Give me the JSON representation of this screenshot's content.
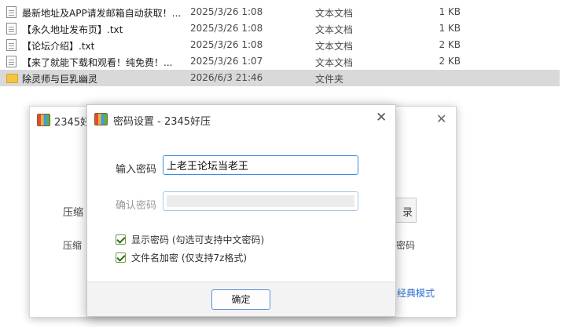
{
  "files": [
    {
      "name": "最新地址及APP请发邮箱自动获取！...",
      "date": "2025/3/26 1:08",
      "type": "文本文档",
      "size": "1 KB",
      "icon": "text-file-icon"
    },
    {
      "name": "【永久地址发布页】.txt",
      "date": "2025/3/26 1:08",
      "type": "文本文档",
      "size": "1 KB",
      "icon": "text-file-icon"
    },
    {
      "name": "【论坛介绍】.txt",
      "date": "2025/3/26 1:08",
      "type": "文本文档",
      "size": "2 KB",
      "icon": "text-file-icon"
    },
    {
      "name": "【来了就能下载和观看！纯免费！...",
      "date": "2025/3/26 1:07",
      "type": "文本文档",
      "size": "2 KB",
      "icon": "text-file-icon"
    },
    {
      "name": "除灵师与巨乳幽灵",
      "date": "2026/6/3 21:46",
      "type": "文件夹",
      "size": "",
      "icon": "folder-icon"
    }
  ],
  "main_window": {
    "title": "2345好",
    "label_a": "压缩",
    "label_b": "压缩",
    "browse_label": "录",
    "password_text": "密码",
    "classic_link": "经典模式"
  },
  "dialog": {
    "title": "密码设置 - 2345好压",
    "close": "✕",
    "password_label": "输入密码",
    "password_value": "上老王论坛当老王",
    "confirm_label": "确认密码",
    "show_password_label": "显示密码 (勾选可支持中文密码)",
    "encrypt_names_label": "文件名加密 (仅支持7z格式)",
    "ok_label": "确定"
  }
}
